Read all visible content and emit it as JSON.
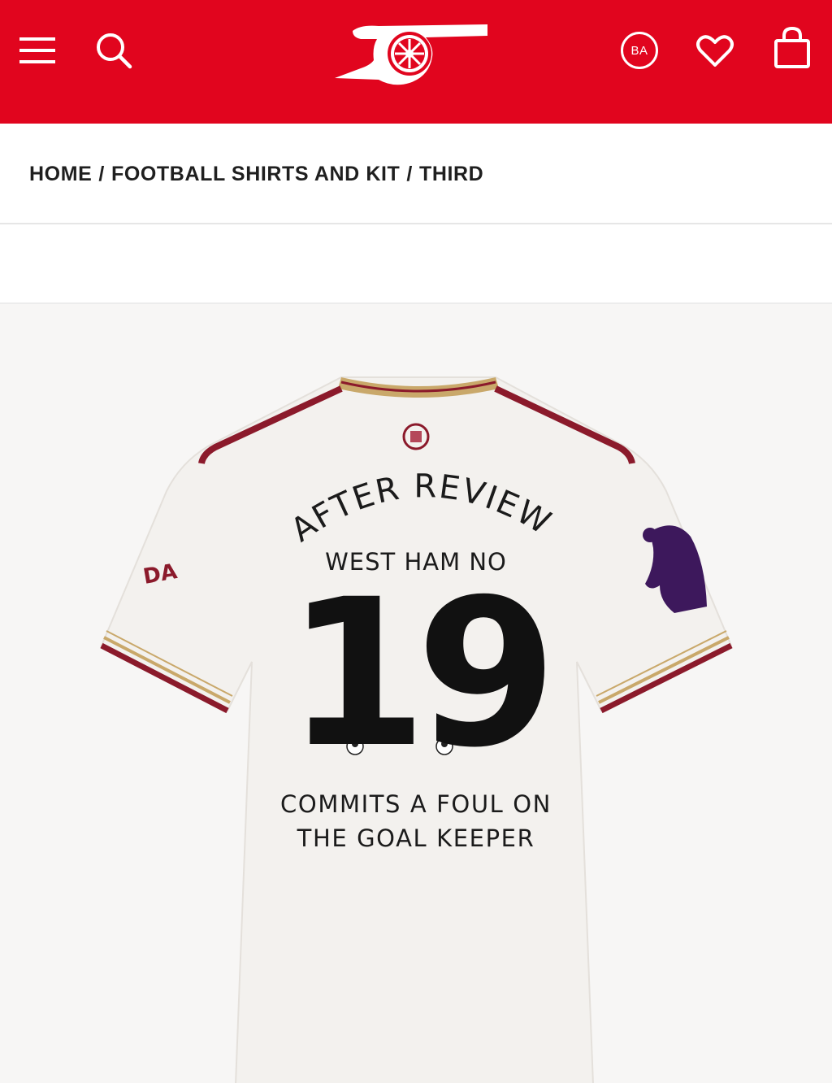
{
  "header": {
    "account_initials": "BA",
    "brand_color": "#e1051e",
    "icons": [
      "menu-icon",
      "search-icon",
      "club-crest-logo",
      "heart-icon",
      "bag-icon"
    ]
  },
  "breadcrumb": {
    "items": [
      "HOME",
      "FOOTBALL SHIRTS AND KIT",
      "THIRD"
    ],
    "separator": "/"
  },
  "product": {
    "arc_text": "AFTER REVIEW",
    "name_line": "WEST HAM NO",
    "number": "19",
    "message_line1": "COMMITS A FOUL ON",
    "message_line2": "THE GOAL KEEPER",
    "shirt_color": "#f3f1ee",
    "trim_color": "#8b1a2b",
    "trim_gold": "#c9a86a",
    "sleeve_badge_color": "#3d185c"
  }
}
